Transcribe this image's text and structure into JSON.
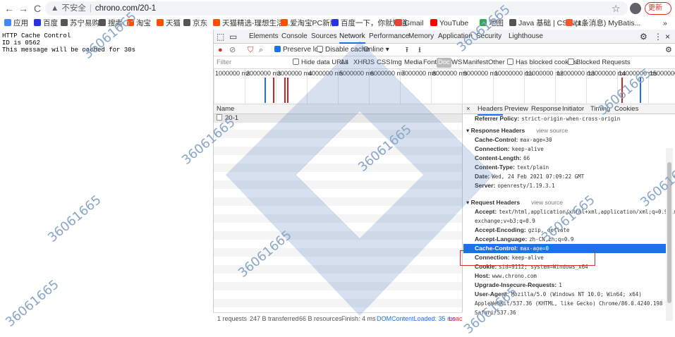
{
  "browser": {
    "nav": {
      "back": "←",
      "forward": "→",
      "reload": "C"
    },
    "url": {
      "security": "不安全",
      "host": "chrono.com/20-1"
    },
    "update_label": "更新"
  },
  "bookmarks": [
    {
      "label": "应用",
      "color": "#4285f4"
    },
    {
      "label": "百度",
      "color": "#2932e1"
    },
    {
      "label": "苏宁易购",
      "color": "#555555"
    },
    {
      "label": "搜索",
      "color": "#555555"
    },
    {
      "label": "淘宝",
      "color": "#ff5000"
    },
    {
      "label": "天猫",
      "color": "#ff5000"
    },
    {
      "label": "京东",
      "color": "#555555"
    },
    {
      "label": "天猫精选-理想生活...",
      "color": "#ff5000"
    },
    {
      "label": "爱淘宝PC新版",
      "color": "#ff5000"
    },
    {
      "label": "百度一下，你就知道",
      "color": "#2932e1"
    },
    {
      "label": "Gmail",
      "color": "#ea4335"
    },
    {
      "label": "YouTube",
      "color": "#ff0000"
    },
    {
      "label": "地图",
      "color": "#34a853"
    },
    {
      "label": "Java 基础 | CS-Not...",
      "color": "#555555"
    },
    {
      "label": "(1条消息) MyBatis...",
      "color": "#fc5531"
    }
  ],
  "page": {
    "lines": [
      "HTTP Cache Control",
      "ID is 0562",
      "This message will be cached for 30s"
    ]
  },
  "devtools": {
    "tabs": [
      "Elements",
      "Console",
      "Sources",
      "Network",
      "Performance",
      "Memory",
      "Application",
      "Security",
      "Lighthouse"
    ],
    "active_tab": "Network",
    "toolbar": {
      "preserve_log": "Preserve log",
      "disable_cache": "Disable cache",
      "throttle": "Online"
    },
    "filter": {
      "placeholder": "Filter",
      "hide_data_urls": "Hide data URLs",
      "types": [
        "All",
        "XHR",
        "JS",
        "CSS",
        "Img",
        "Media",
        "Font",
        "Doc",
        "WS",
        "Manifest",
        "Other"
      ],
      "has_blocked_cookies": "Has blocked cookies",
      "blocked_requests": "Blocked Requests"
    },
    "timeline_ticks": [
      "1000000 ms",
      "2000000 ms",
      "3000000 ms",
      "4000000 ms",
      "5000000 ms",
      "6000000 ms",
      "7000000 ms",
      "8000000 ms",
      "9000000 ms",
      "10000000 ms",
      "11000000 ms",
      "12000000 ms",
      "13000000 ms",
      "14000000 ms",
      "15000000 ms"
    ],
    "name_header": "Name",
    "requests": [
      {
        "name": "20-1"
      }
    ],
    "detail_tabs": [
      "Headers",
      "Preview",
      "Response",
      "Initiator",
      "Timing",
      "Cookies"
    ],
    "referrer_policy": {
      "name": "Referrer Policy:",
      "value": "strict-origin-when-cross-origin"
    },
    "response_headers": {
      "title": "Response Headers",
      "view_source": "view source",
      "items": [
        {
          "name": "Cache-Control:",
          "value": "max-age=30"
        },
        {
          "name": "Connection:",
          "value": "keep-alive"
        },
        {
          "name": "Content-Length:",
          "value": "66"
        },
        {
          "name": "Content-Type:",
          "value": "text/plain"
        },
        {
          "name": "Date:",
          "value": "Wed, 24 Feb 2021 07:09:22 GMT"
        },
        {
          "name": "Server:",
          "value": "openresty/1.19.3.1"
        }
      ]
    },
    "request_headers": {
      "title": "Request Headers",
      "view_source": "view source",
      "items": [
        {
          "name": "Accept:",
          "value": "text/html,application/xhtml+xml,application/xml;q=0.9,image/avif,image/webp,image/apng,*/*;q=0.8,application/signed-exchange;v=b3;q=0.9"
        },
        {
          "name": "Accept-Encoding:",
          "value": "gzip, deflate"
        },
        {
          "name": "Accept-Language:",
          "value": "zh-CN,zh;q=0.9"
        },
        {
          "name": "Cache-Control:",
          "value": "max-age=0",
          "selected": true
        },
        {
          "name": "Connection:",
          "value": "keep-alive"
        },
        {
          "name": "Cookie:",
          "value": "sid=9112; system=Windows_x64"
        },
        {
          "name": "Host:",
          "value": "www.chrono.com"
        },
        {
          "name": "Upgrade-Insecure-Requests:",
          "value": "1"
        },
        {
          "name": "User-Agent:",
          "value": "Mozilla/5.0 (Windows NT 10.0; Win64; x64) AppleWebKit/537.36 (KHTML, like Gecko) Chrome/86.0.4240.198 Safari/537.36"
        }
      ]
    },
    "status": {
      "requests": "1 requests",
      "transferred": "247 B transferred",
      "resources": "66 B resources",
      "finish": "Finish: 4 ms",
      "dom_loaded": "DOMContentLoaded: 35 ms",
      "load": "Loac"
    }
  },
  "watermark": "36061665"
}
